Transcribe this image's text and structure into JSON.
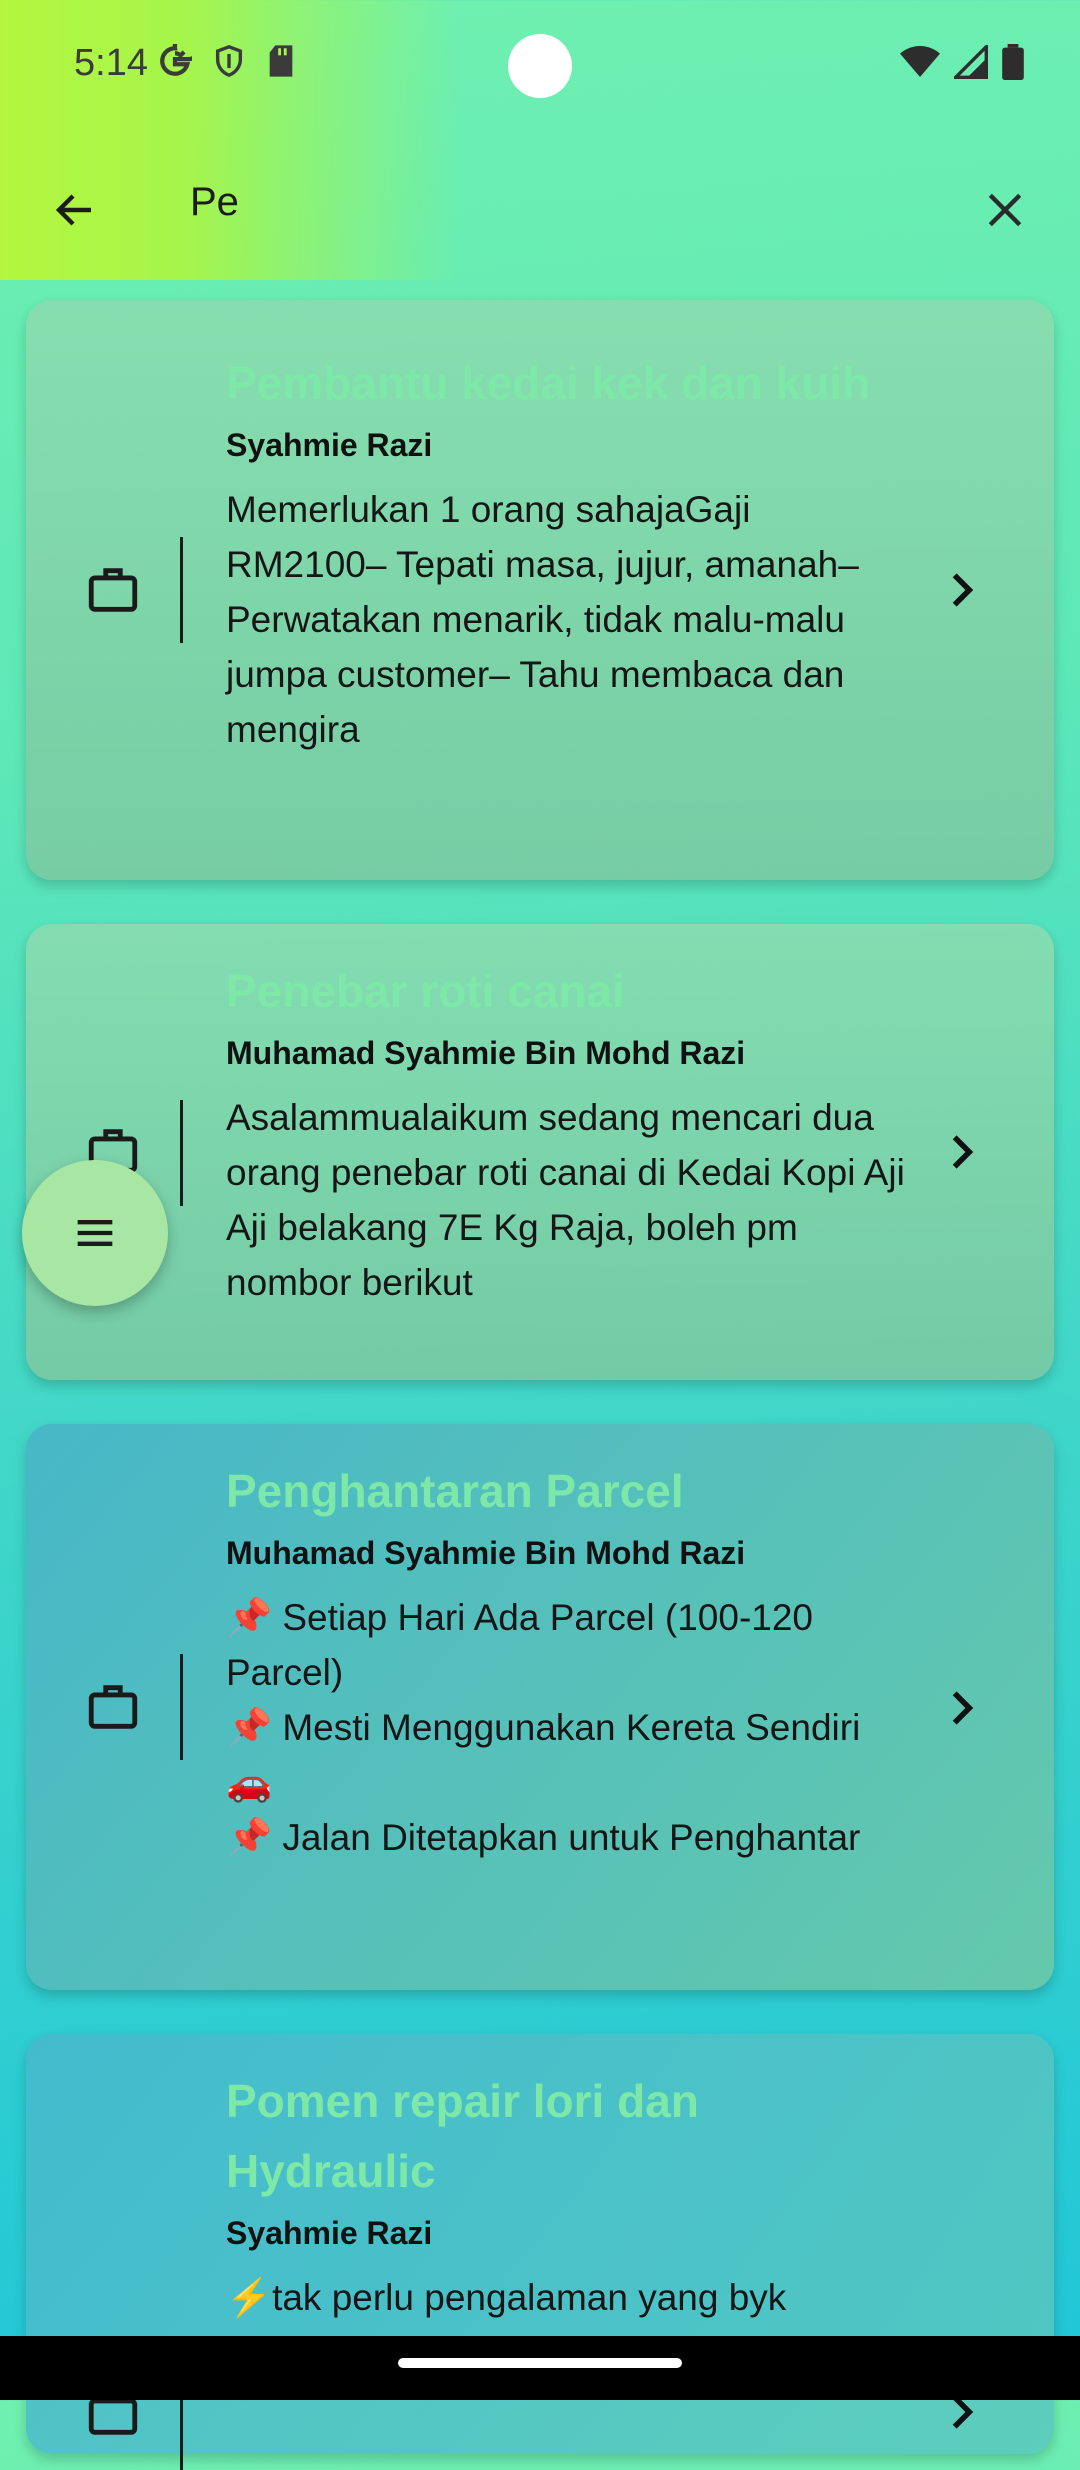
{
  "status_bar": {
    "time": "5:14"
  },
  "search": {
    "query": "Pe"
  },
  "jobs": [
    {
      "title": "Pembantu kedai kek dan kuih",
      "author": "Syahmie Razi",
      "description": "Memerlukan 1 orang sahajaGaji RM2100– Tepati masa, jujur, amanah– Perwatakan menarik, tidak malu-malu jumpa customer– Tahu membaca dan mengira"
    },
    {
      "title": "Penebar roti canai",
      "author": "Muhamad Syahmie Bin Mohd Razi",
      "description": "Asalammualaikum sedang mencari dua orang penebar roti canai di Kedai Kopi Aji Aji belakang 7E Kg Raja, boleh pm nombor berikut"
    },
    {
      "title": "Penghantaran Parcel",
      "author": "Muhamad Syahmie Bin Mohd Razi",
      "description": "📌 Setiap Hari Ada Parcel (100-120 Parcel)\n📌 Mesti Menggunakan Kereta Sendiri 🚗\n📌 Jalan Ditetapkan untuk Penghantar"
    },
    {
      "title": "Pomen repair lori dan Hydraulic",
      "author": "Syahmie Razi",
      "description": "⚡tak perlu pengalaman yang byk"
    }
  ],
  "colors": {
    "title_accent": "#7ee8a8",
    "fab": "#a8e6a4"
  },
  "icons": {
    "back": "arrow-left-icon",
    "close": "close-icon",
    "job": "briefcase-icon",
    "chevron": "chevron-right-icon",
    "fab": "menu-icon"
  }
}
